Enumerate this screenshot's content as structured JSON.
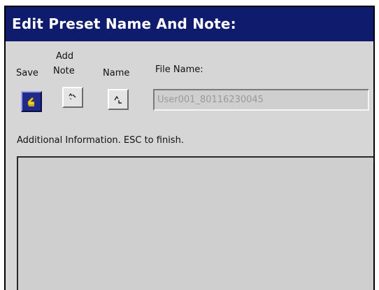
{
  "window": {
    "title": "Edit Preset Name And Note:"
  },
  "toolbar": {
    "save_label": "Save",
    "add_note_label_line1": "Add",
    "add_note_label_line2": "Note",
    "name_label": "Name",
    "save_icon": "save-document-icon",
    "add_note_icon": "note-edit-icon",
    "name_icon": "rename-icon"
  },
  "file_name": {
    "label": "File Name:",
    "value": "User001_80116230045"
  },
  "additional_info": {
    "label": "Additional Information. ESC to finish.",
    "value": ""
  },
  "colors": {
    "title_bar": "#0f1c6e",
    "panel_background": "#d6d6d6"
  }
}
